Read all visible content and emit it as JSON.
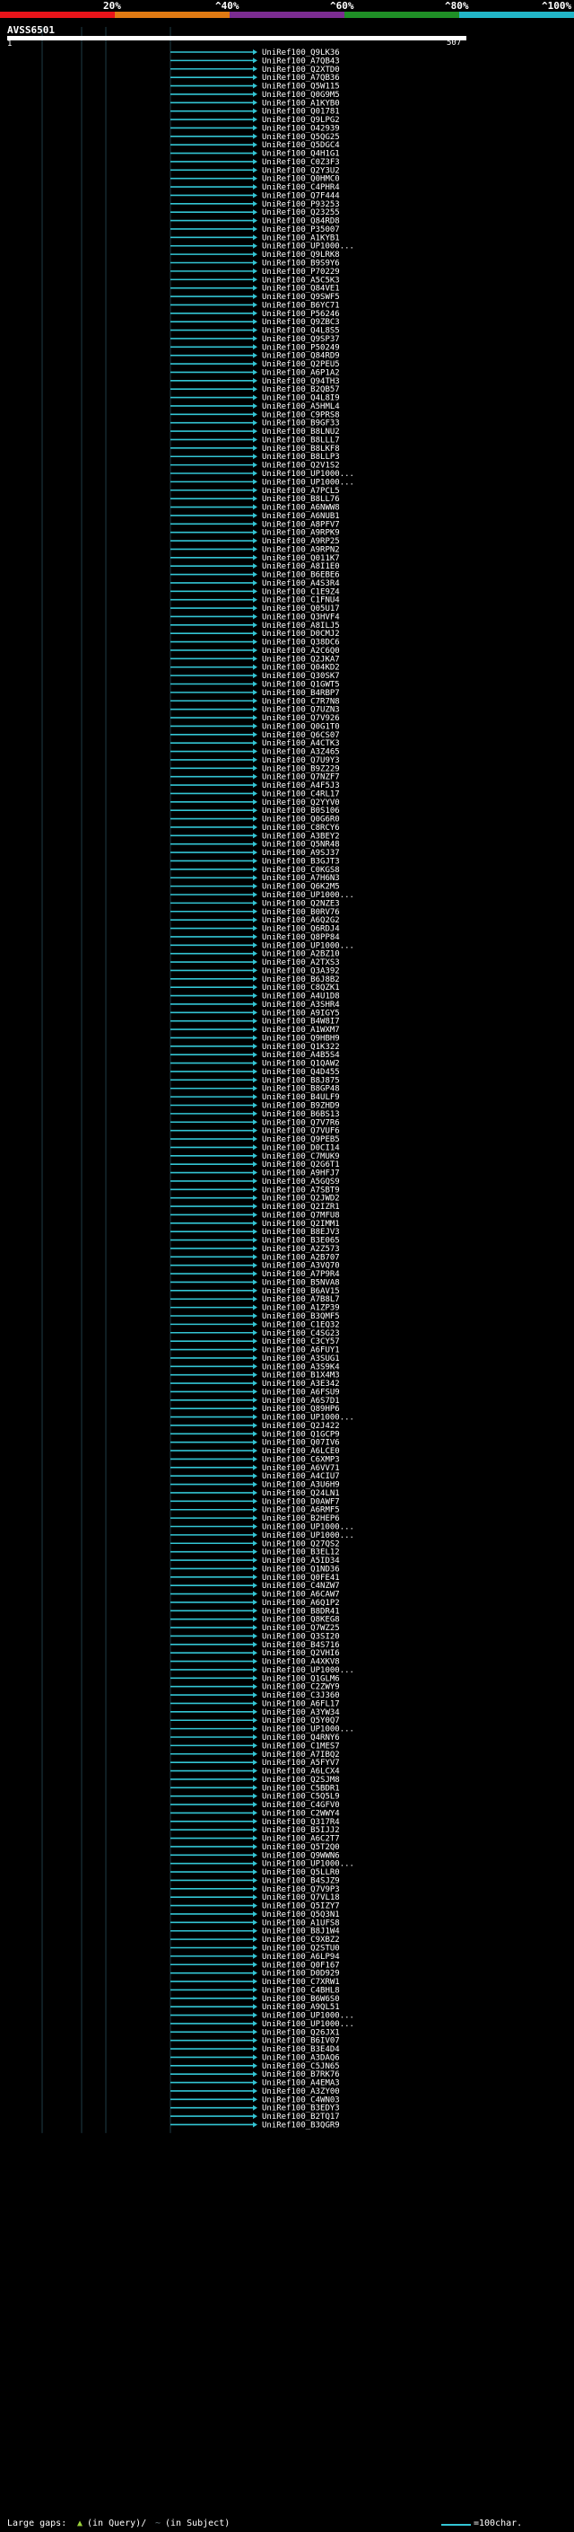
{
  "scale": {
    "labels": [
      "20%",
      "^40%",
      "^60%",
      "^80%",
      "^100%"
    ],
    "colors": [
      "#e8141a",
      "#e07a13",
      "#7b2c91",
      "#1f8f26",
      "#22b6c8"
    ]
  },
  "query": {
    "name": "AVSS6501",
    "start": "1",
    "end": "507"
  },
  "colors": {
    "hit": "#33c5d4",
    "hit_alt": "#9ad23a",
    "gap": "#6b7b82",
    "grid": "#1e3c46",
    "background": "#000000"
  },
  "hits": [
    "UniRef100_Q9LK36",
    "UniRef100_A7QB43",
    "UniRef100_Q2XTD0",
    "UniRef100_A7QB36",
    "UniRef100_Q5W115",
    "UniRef100_Q0G9M5",
    "UniRef100_A1KYB0",
    "UniRef100_Q01781",
    "UniRef100_Q9LPG2",
    "UniRef100_O42939",
    "UniRef100_Q5QG25",
    "UniRef100_Q5DGC4",
    "UniRef100_Q4H1G1",
    "UniRef100_C0Z3F3",
    "UniRef100_Q2Y3U2",
    "UniRef100_Q0HMC0",
    "UniRef100_C4PHR4",
    "UniRef100_Q7F444",
    "UniRef100_P93253",
    "UniRef100_Q23255",
    "UniRef100_Q84RD8",
    "UniRef100_P35007",
    "UniRef100_A1KYB1",
    "UniRef100_UP1000...",
    "UniRef100_Q9LRK8",
    "UniRef100_B9S9Y6",
    "UniRef100_P70229",
    "UniRef100_A5C5K3",
    "UniRef100_Q84VE1",
    "UniRef100_Q9SWF5",
    "UniRef100_B6YC71",
    "UniRef100_P56246",
    "UniRef100_Q9ZBC3",
    "UniRef100_Q4L8S5",
    "UniRef100_Q9SP37",
    "UniRef100_P50249",
    "UniRef100_Q84RD9",
    "UniRef100_Q2PEU5",
    "UniRef100_A6P1A2",
    "UniRef100_Q94TH3",
    "UniRef100_B2QB57",
    "UniRef100_Q4L8I9",
    "UniRef100_A5HML4",
    "UniRef100_C9PRS8",
    "UniRef100_B9GF33",
    "UniRef100_B8LNU2",
    "UniRef100_B8LLL7",
    "UniRef100_B8LKF8",
    "UniRef100_B8LLP3",
    "UniRef100_Q2V1S2",
    "UniRef100_UP1000...",
    "UniRef100_UP1000...",
    "UniRef100_A7PCL5",
    "UniRef100_B8LL76",
    "UniRef100_A6NWW8",
    "UniRef100_A6NUB1",
    "UniRef100_A8PFV7",
    "UniRef100_A9RPK9",
    "UniRef100_A9RP25",
    "UniRef100_A9RPN2",
    "UniRef100_Q011K7",
    "UniRef100_A8I1E0",
    "UniRef100_B6EBE6",
    "UniRef100_A4S3R4",
    "UniRef100_C1E9Z4",
    "UniRef100_C1FNU4",
    "UniRef100_Q05U17",
    "UniRef100_Q3HVF4",
    "UniRef100_A8ILJ5",
    "UniRef100_D0CMJ2",
    "UniRef100_Q38DC6",
    "UniRef100_A2C6Q0",
    "UniRef100_Q2JKA7",
    "UniRef100_Q04KD2",
    "UniRef100_Q30SK7",
    "UniRef100_Q1GWT5",
    "UniRef100_B4RBP7",
    "UniRef100_C7R7N8",
    "UniRef100_Q7UZN3",
    "UniRef100_Q7V926",
    "UniRef100_Q0G1T0",
    "UniRef100_Q6CS07",
    "UniRef100_A4CTK3",
    "UniRef100_A3Z465",
    "UniRef100_Q7U9Y3",
    "UniRef100_B9Z229",
    "UniRef100_Q7NZF7",
    "UniRef100_A4F5J3",
    "UniRef100_C4RL17",
    "UniRef100_Q2YYV0",
    "UniRef100_B0S106",
    "UniRef100_Q0G6R0",
    "UniRef100_C8RCY6",
    "UniRef100_A3BEY2",
    "UniRef100_Q5NR48",
    "UniRef100_A9SJ37",
    "UniRef100_B3GJT3",
    "UniRef100_C0KGS8",
    "UniRef100_A7H6N3",
    "UniRef100_Q6K2M5",
    "UniRef100_UP1000...",
    "UniRef100_Q2NZE3",
    "UniRef100_B0RV76",
    "UniRef100_A6Q2G2",
    "UniRef100_Q6RDJ4",
    "UniRef100_Q8PP84",
    "UniRef100_UP1000...",
    "UniRef100_A2BZ10",
    "UniRef100_A2TXS3",
    "UniRef100_Q3A392",
    "UniRef100_B6J8B2",
    "UniRef100_C8QZK1",
    "UniRef100_A4U1D8",
    "UniRef100_A3SHR4",
    "UniRef100_A9IGY5",
    "UniRef100_B4W8I7",
    "UniRef100_A1WXM7",
    "UniRef100_Q9HBH9",
    "UniRef100_Q1K322",
    "UniRef100_A4B5S4",
    "UniRef100_Q1QAW2",
    "UniRef100_Q4D455",
    "UniRef100_B8J875",
    "UniRef100_B8GP48",
    "UniRef100_B4ULF9",
    "UniRef100_B9ZHD9",
    "UniRef100_B6BS13",
    "UniRef100_Q7V7R6",
    "UniRef100_Q7VUF6",
    "UniRef100_Q9PEB5",
    "UniRef100_D0CI14",
    "UniRef100_C7MUK9",
    "UniRef100_Q2G6T1",
    "UniRef100_A9HFJ7",
    "UniRef100_A5GQS9",
    "UniRef100_A7SBT9",
    "UniRef100_Q2JWD2",
    "UniRef100_Q2IZR1",
    "UniRef100_Q7MFU8",
    "UniRef100_Q2IMM1",
    "UniRef100_B8EJV3",
    "UniRef100_B3E065",
    "UniRef100_A2Z573",
    "UniRef100_A2B707",
    "UniRef100_A3VQ70",
    "UniRef100_A7P9R4",
    "UniRef100_B5NVA8",
    "UniRef100_B6AV15",
    "UniRef100_A7B8L7",
    "UniRef100_A1ZP39",
    "UniRef100_B3QMF5",
    "UniRef100_C1EQ32",
    "UniRef100_C4SG23",
    "UniRef100_C3CY57",
    "UniRef100_A6FUY1",
    "UniRef100_A3SUG1",
    "UniRef100_A3S9K4",
    "UniRef100_B1X4M3",
    "UniRef100_A3E342",
    "UniRef100_A6FSU9",
    "UniRef100_A6S7D1",
    "UniRef100_Q89HP6",
    "UniRef100_UP1000...",
    "UniRef100_Q2J422",
    "UniRef100_Q1GCP9",
    "UniRef100_Q07IV6",
    "UniRef100_A6LCE0",
    "UniRef100_C6XMP3",
    "UniRef100_A6VV71",
    "UniRef100_A4CIU7",
    "UniRef100_A3U6H9",
    "UniRef100_Q24LN1",
    "UniRef100_D0AWF7",
    "UniRef100_A6RMF5",
    "UniRef100_B2HEP6",
    "UniRef100_UP1000...",
    "UniRef100_UP1000...",
    "UniRef100_Q27QS2",
    "UniRef100_B3EL12",
    "UniRef100_A5ID34",
    "UniRef100_Q1ND36",
    "UniRef100_Q0FE41",
    "UniRef100_C4NZW7",
    "UniRef100_A6CAW7",
    "UniRef100_A6Q1P2",
    "UniRef100_B8DR41",
    "UniRef100_Q8KEG8",
    "UniRef100_Q7WZ25",
    "UniRef100_Q3SI20",
    "UniRef100_B4S716",
    "UniRef100_Q2VHI6",
    "UniRef100_A4XKV8",
    "UniRef100_UP1000...",
    "UniRef100_Q1GLM6",
    "UniRef100_C2ZWY9",
    "UniRef100_C3J360",
    "UniRef100_A6FL17",
    "UniRef100_A3YW34",
    "UniRef100_Q5Y0Q7",
    "UniRef100_UP1000...",
    "UniRef100_Q4RNY6",
    "UniRef100_C1MES7",
    "UniRef100_A7IBQ2",
    "UniRef100_A5FYV7",
    "UniRef100_A6LCX4",
    "UniRef100_Q2SJM8",
    "UniRef100_C5BDR1",
    "UniRef100_C5Q5L9",
    "UniRef100_C4GFV0",
    "UniRef100_C2WWY4",
    "UniRef100_Q317R4",
    "UniRef100_B5IJJ2",
    "UniRef100_A6C2T7",
    "UniRef100_Q5T2Q0",
    "UniRef100_Q9WWN6",
    "UniRef100_UP1000...",
    "UniRef100_Q5LLR0",
    "UniRef100_B4SJZ9",
    "UniRef100_Q7V9P3",
    "UniRef100_Q7VL18",
    "UniRef100_Q5IZY7",
    "UniRef100_Q5Q3N1",
    "UniRef100_A1UFS8",
    "UniRef100_B8J1W4",
    "UniRef100_C9XBZ2",
    "UniRef100_Q2STU0",
    "UniRef100_A6LP94",
    "UniRef100_Q0F167",
    "UniRef100_D0D929",
    "UniRef100_C7XRW1",
    "UniRef100_C4BHL8",
    "UniRef100_B6W6S0",
    "UniRef100_A9QL51",
    "UniRef100_UP1000...",
    "UniRef100_UP1000...",
    "UniRef100_Q26JX1",
    "UniRef100_B6IV07",
    "UniRef100_B3E4D4",
    "UniRef100_A3DAQ6",
    "UniRef100_C5JN65",
    "UniRef100_B7RK76",
    "UniRef100_A4EMA3",
    "UniRef100_A3ZY00",
    "UniRef100_C4WN03",
    "UniRef100_B3EDY3",
    "UniRef100_B2TQ17",
    "UniRef100_B3QGR9"
  ],
  "footer": {
    "large_gaps_label": "Large gaps:",
    "query_gap": "(in Query)/",
    "subject_gap": "(in Subject)",
    "scale_note": "=100char."
  }
}
